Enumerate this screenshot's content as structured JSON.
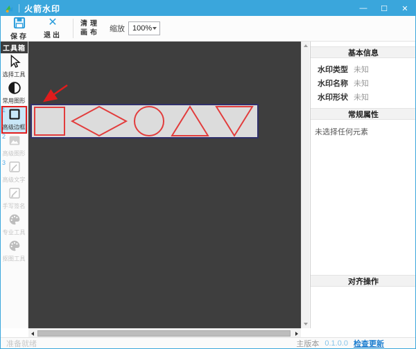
{
  "titlebar": {
    "title": "火箭水印",
    "minimize_glyph": "—",
    "maximize_glyph": "☐",
    "close_glyph": "✕"
  },
  "toolbar": {
    "save_label": "保存",
    "exit_label": "退出",
    "exit_glyph": "✕",
    "clear_canvas_line1": "清理",
    "clear_canvas_line2": "画布",
    "zoom_label": "缩放",
    "zoom_value": "100%"
  },
  "sidebar": {
    "header": "工具箱",
    "items": [
      {
        "label": "选择工具",
        "icon": "cursor-icon",
        "state": "normal",
        "badge": ""
      },
      {
        "label": "常用图形",
        "icon": "shapes-icon",
        "state": "normal",
        "badge": ""
      },
      {
        "label": "高级边框",
        "icon": "border-icon",
        "state": "selected",
        "badge": "1"
      },
      {
        "label": "高级图形",
        "icon": "image-icon",
        "state": "disabled",
        "badge": "2"
      },
      {
        "label": "高级文字",
        "icon": "text-pencil-icon",
        "state": "disabled",
        "badge": "3"
      },
      {
        "label": "手写签名",
        "icon": "signature-pencil-icon",
        "state": "disabled",
        "badge": ""
      },
      {
        "label": "专业工具",
        "icon": "palette-icon",
        "state": "disabled",
        "badge": ""
      },
      {
        "label": "抠图工具",
        "icon": "palette-icon",
        "state": "disabled",
        "badge": ""
      }
    ]
  },
  "canvas": {
    "background_color": "#3e3e3e",
    "strip_fill": "#dcdcdc",
    "strip_border": "#30306b",
    "shape_color": "#e23c3c",
    "annotation_color": "#e11c1c",
    "shapes": [
      "square",
      "diamond",
      "circle",
      "triangle",
      "inverted-triangle"
    ]
  },
  "panel": {
    "basic_info": {
      "title": "基本信息",
      "rows": [
        {
          "label": "水印类型",
          "value": "未知"
        },
        {
          "label": "水印名称",
          "value": "未知"
        },
        {
          "label": "水印形状",
          "value": "未知"
        }
      ]
    },
    "general_props": {
      "title": "常规属性",
      "empty_text": "未选择任何元素"
    },
    "align_ops": {
      "title": "对齐操作"
    }
  },
  "statusbar": {
    "ready_text": "准备就绪",
    "version_label": "主版本",
    "version_value": "0.1.0.0",
    "update_link": "检查更新"
  }
}
